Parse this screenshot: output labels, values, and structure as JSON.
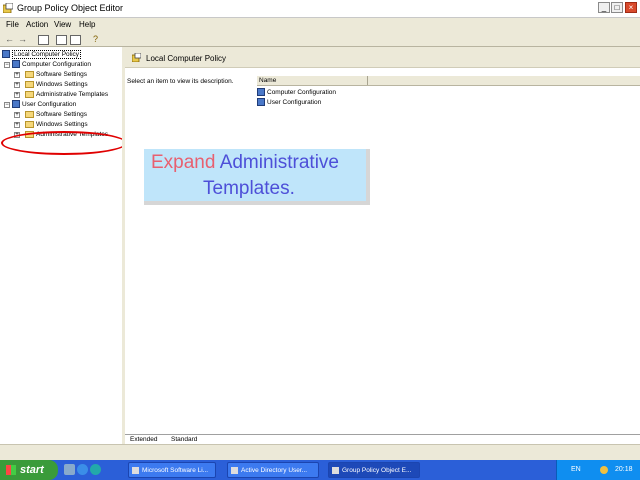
{
  "window": {
    "title": "Group Policy Object Editor"
  },
  "menu": [
    "File",
    "Action",
    "View",
    "Help"
  ],
  "tree": {
    "root": "Local Computer Policy",
    "computer_config": "Computer Configuration",
    "cc_children": [
      "Software Settings",
      "Windows Settings",
      "Administrative Templates"
    ],
    "user_config": "User Configuration",
    "uc_children": [
      "Software Settings",
      "Windows Settings",
      "Administrative Templates"
    ]
  },
  "right_pane": {
    "title": "Local Computer Policy",
    "description": "Select an item to view its description.",
    "column_name": "Name",
    "items": [
      "Computer Configuration",
      "User Configuration"
    ]
  },
  "callout": {
    "word1": "Expand",
    "word2": "Administrative",
    "line2": "Templates.",
    "color_red": "#e86070",
    "color_blue": "#4d4fd8"
  },
  "tabs": [
    "Extended",
    "Standard"
  ],
  "taskbar": {
    "start": "start",
    "tasks": [
      "Microsoft Software Li...",
      "Active Directory User...",
      "Group Policy Object E..."
    ],
    "language": "EN",
    "clock": "20:18"
  }
}
